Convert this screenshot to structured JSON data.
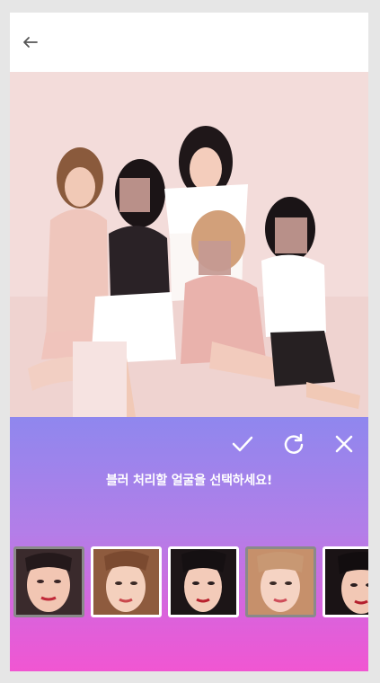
{
  "header": {
    "back_icon": "arrow-left-icon"
  },
  "photo": {
    "description_icon": "group-photo"
  },
  "panel": {
    "title": "블러 처리할 얼굴을 선택하세요!",
    "actions": [
      {
        "name": "confirm-button",
        "icon": "check-icon"
      },
      {
        "name": "reset-button",
        "icon": "refresh-icon"
      },
      {
        "name": "close-button",
        "icon": "close-icon"
      }
    ],
    "faces": [
      {
        "id": "face-1",
        "selected": false
      },
      {
        "id": "face-2",
        "selected": true
      },
      {
        "id": "face-3",
        "selected": true
      },
      {
        "id": "face-4",
        "selected": false
      },
      {
        "id": "face-5",
        "selected": true
      }
    ]
  },
  "colors": {
    "panel_top": "#8f87ee",
    "panel_bottom": "#f156d2",
    "selected_border": "#ffffff",
    "unselected_border": "#8a8a8a"
  }
}
